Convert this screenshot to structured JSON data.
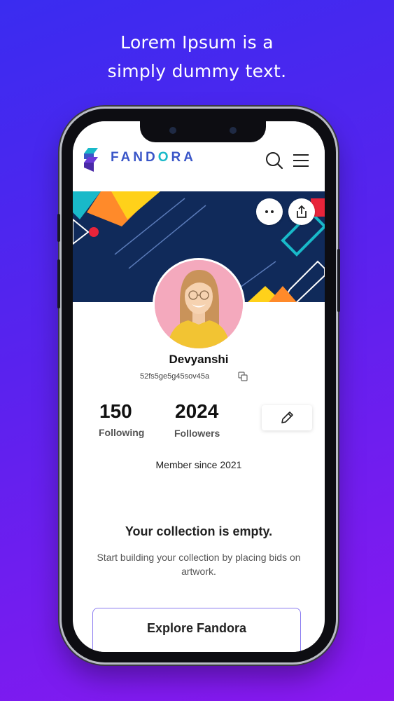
{
  "headline": {
    "line1": "Lorem Ipsum is a",
    "line2": "simply dummy text."
  },
  "app": {
    "logo_prefix": "FAND",
    "logo_accent": "O",
    "logo_suffix": "RA",
    "icons": {
      "search": "search-icon",
      "menu": "hamburger-menu-icon",
      "more": "more-options-icon",
      "share": "share-icon",
      "edit": "pencil-icon",
      "copy": "copy-icon"
    }
  },
  "profile": {
    "name": "Devyanshi",
    "wallet": "52fs5ge5g45sov45a",
    "following_count": "150",
    "following_label": "Following",
    "followers_count": "2024",
    "followers_label": "Followers",
    "member_since": "Member since  2021"
  },
  "collection": {
    "empty_title": "Your collection is empty.",
    "empty_desc": "Start building your collection by placing bids on artwork.",
    "explore_label": "Explore Fandora"
  },
  "colors": {
    "brand": "#3a56c8",
    "brand_accent": "#19b9c9",
    "banner": "#102a5a",
    "bg_start": "#3a2cf0",
    "bg_end": "#8a18f0"
  }
}
